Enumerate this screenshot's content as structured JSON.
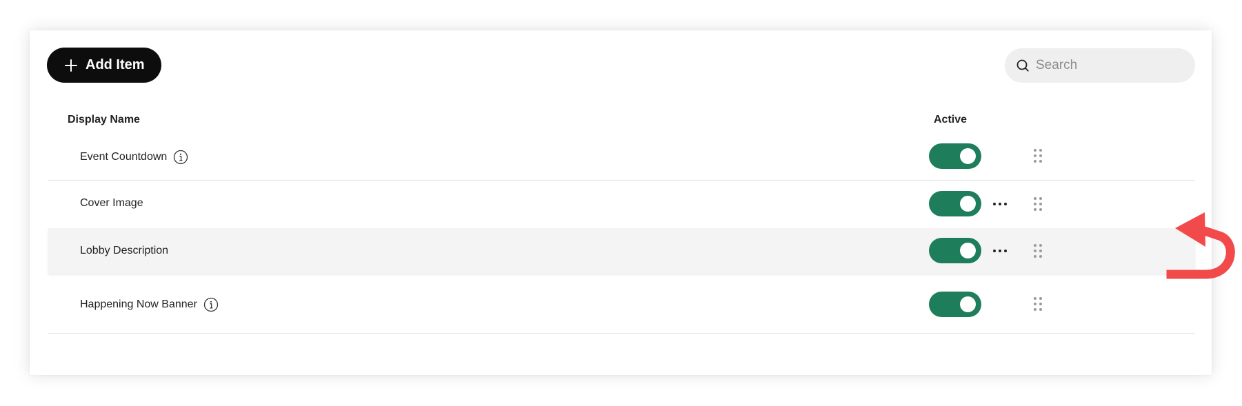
{
  "toolbar": {
    "add_label": "Add Item",
    "search_placeholder": "Search"
  },
  "table": {
    "headers": {
      "name": "Display Name",
      "active": "Active"
    },
    "rows": [
      {
        "name": "Event Countdown",
        "has_info": true,
        "active": true,
        "has_more_menu": false
      },
      {
        "name": "Cover Image",
        "has_info": false,
        "active": true,
        "has_more_menu": true
      },
      {
        "name": "Lobby Description",
        "has_info": false,
        "active": true,
        "has_more_menu": true,
        "highlighted": true
      },
      {
        "name": "Happening Now Banner",
        "has_info": true,
        "active": true,
        "has_more_menu": false
      }
    ]
  },
  "colors": {
    "toggle_on": "#1e7d5b",
    "button_bg": "#0d0d0d",
    "annotation_arrow": "#f24a4a"
  },
  "icons": {
    "add": "plus-icon",
    "search": "search-icon",
    "info": "info-icon",
    "more": "more-horizontal-icon",
    "drag": "drag-handle-icon"
  }
}
